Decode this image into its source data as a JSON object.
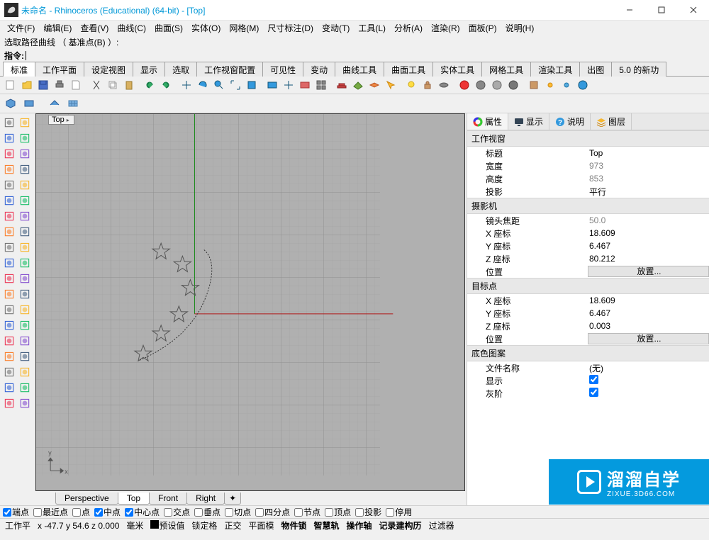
{
  "title": "未命名 - Rhinoceros (Educational) (64-bit) - [Top]",
  "menubar": [
    "文件(F)",
    "编辑(E)",
    "查看(V)",
    "曲线(C)",
    "曲面(S)",
    "实体(O)",
    "网格(M)",
    "尺寸标注(D)",
    "变动(T)",
    "工具(L)",
    "分析(A)",
    "渲染(R)",
    "面板(P)",
    "说明(H)"
  ],
  "cmd_history": "选取路径曲线 （ 基准点(B) ）:",
  "cmd_prompt": "指令:",
  "tool_tabs": [
    "标准",
    "工作平面",
    "设定视图",
    "显示",
    "选取",
    "工作视窗配置",
    "可见性",
    "变动",
    "曲线工具",
    "曲面工具",
    "实体工具",
    "网格工具",
    "渲染工具",
    "出图",
    "5.0 的新功"
  ],
  "tool_tabs_active": 0,
  "viewport_label": "Top",
  "bottom_tabs": [
    "Perspective",
    "Top",
    "Front",
    "Right"
  ],
  "bottom_tabs_active": 1,
  "right_tabs": [
    {
      "icon": "circle",
      "label": "属性"
    },
    {
      "icon": "monitor",
      "label": "显示"
    },
    {
      "icon": "help",
      "label": "说明"
    },
    {
      "icon": "layers",
      "label": "图层"
    }
  ],
  "right_tabs_active": 0,
  "props": {
    "sect_viewport": "工作视窗",
    "viewport_title_k": "标题",
    "viewport_title_v": "Top",
    "viewport_w_k": "宽度",
    "viewport_w_v": "973",
    "viewport_h_k": "高度",
    "viewport_h_v": "853",
    "viewport_proj_k": "投影",
    "viewport_proj_v": "平行",
    "sect_camera": "摄影机",
    "cam_focal_k": "镜头焦距",
    "cam_focal_v": "50.0",
    "cam_x_k": "X 座标",
    "cam_x_v": "18.609",
    "cam_y_k": "Y 座标",
    "cam_y_v": "6.467",
    "cam_z_k": "Z 座标",
    "cam_z_v": "80.212",
    "cam_pos_k": "位置",
    "cam_pos_v": "放置...",
    "sect_target": "目标点",
    "tgt_x_k": "X 座标",
    "tgt_x_v": "18.609",
    "tgt_y_k": "Y 座标",
    "tgt_y_v": "6.467",
    "tgt_z_k": "Z 座标",
    "tgt_z_v": "0.003",
    "tgt_pos_k": "位置",
    "tgt_pos_v": "放置...",
    "sect_wall": "底色图案",
    "wall_file_k": "文件名称",
    "wall_file_v": "(无)",
    "wall_show_k": "显示",
    "wall_show_v": true,
    "wall_gray_k": "灰阶",
    "wall_gray_v": true
  },
  "osnap": [
    {
      "label": "端点",
      "checked": true
    },
    {
      "label": "最近点",
      "checked": false
    },
    {
      "label": "点",
      "checked": false
    },
    {
      "label": "中点",
      "checked": true
    },
    {
      "label": "中心点",
      "checked": true
    },
    {
      "label": "交点",
      "checked": false
    },
    {
      "label": "垂点",
      "checked": false
    },
    {
      "label": "切点",
      "checked": false
    },
    {
      "label": "四分点",
      "checked": false
    },
    {
      "label": "节点",
      "checked": false
    },
    {
      "label": "顶点",
      "checked": false
    },
    {
      "label": "投影",
      "checked": false
    },
    {
      "label": "停用",
      "checked": false
    }
  ],
  "status": {
    "cplane": "工作平",
    "coords": "x -47.7 y 54.6 z 0.000",
    "units": "毫米",
    "layer": "预设值",
    "items": [
      "锁定格",
      "正交",
      "平面模",
      "物件锁",
      "智慧轨",
      "操作轴",
      "记录建构历",
      "过滤器"
    ]
  },
  "watermark": {
    "big": "溜溜自学",
    "small": "ZIXUE.3D66.COM"
  }
}
